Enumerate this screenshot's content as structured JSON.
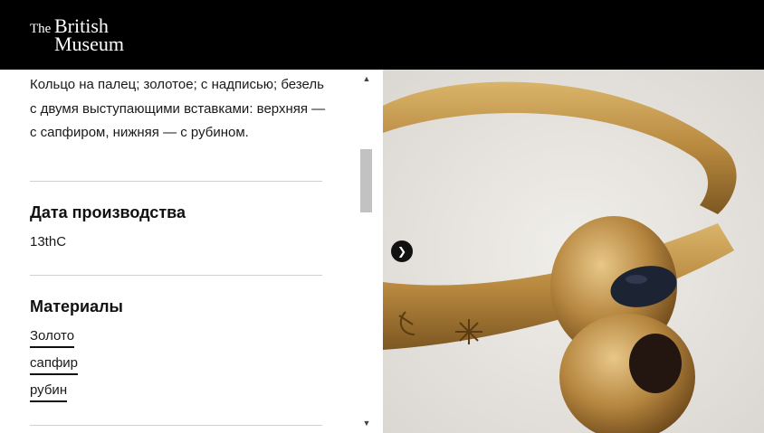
{
  "header": {
    "logo_the": "The",
    "logo_british": "British",
    "logo_museum": "Museum"
  },
  "details": {
    "description": "Кольцо на палец; золотое; с надписью; безель с двумя выступающими вставками: верхняя — с сапфиром, нижняя — с рубином.",
    "production_date_heading": "Дата производства",
    "production_date_value": "13thC",
    "materials_heading": "Материалы",
    "materials": [
      "Золото",
      "сапфир",
      "рубин"
    ]
  },
  "image_viewer": {
    "next_icon": "chevron-right-icon"
  },
  "colors": {
    "header_bg": "#000000",
    "gold": "#b8893f"
  }
}
